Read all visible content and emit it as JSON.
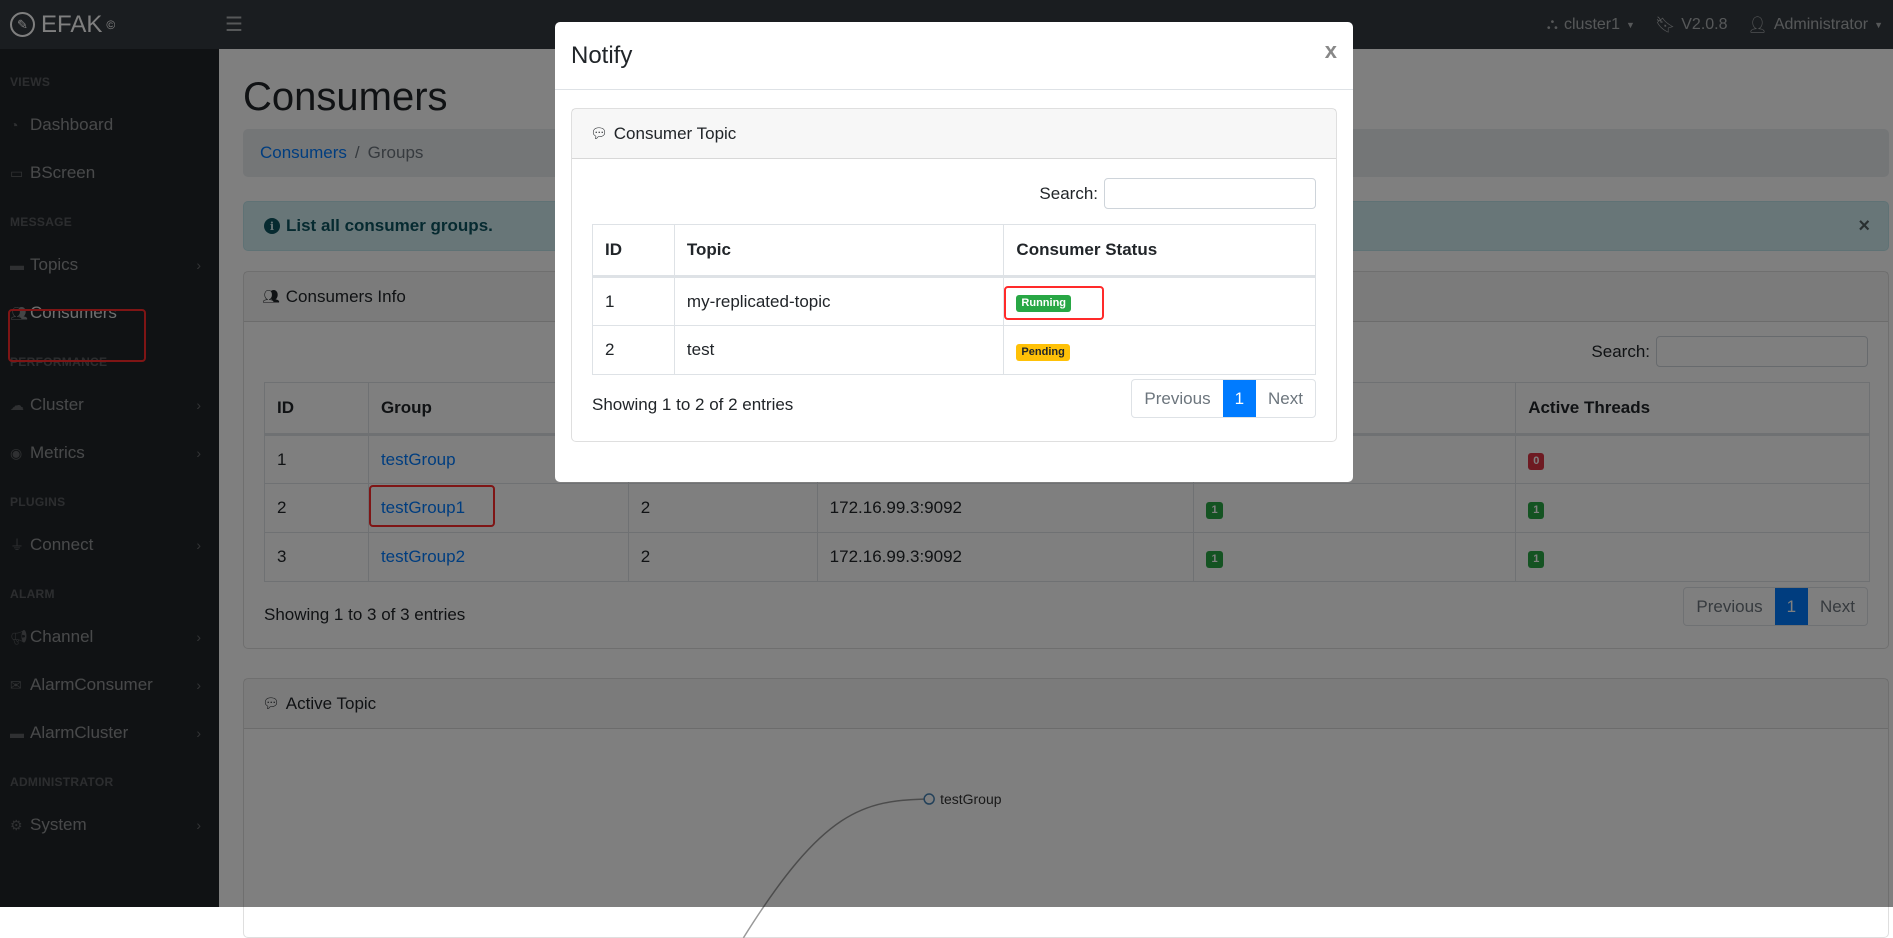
{
  "topbar": {
    "brand": "EFAK",
    "brand_mark": "©",
    "menu_icon": "hamburger-icon",
    "cluster": "cluster1",
    "version": "V2.0.8",
    "user": "Administrator"
  },
  "sidebar": {
    "sections": [
      {
        "heading": "VIEWS",
        "items": [
          {
            "label": "Dashboard",
            "icon": "dashboard-icon",
            "has_children": false
          },
          {
            "label": "BScreen",
            "icon": "monitor-icon",
            "has_children": false
          }
        ]
      },
      {
        "heading": "MESSAGE",
        "items": [
          {
            "label": "Topics",
            "icon": "comment-icon",
            "has_children": true
          },
          {
            "label": "Consumers",
            "icon": "users-icon",
            "has_children": false,
            "active": true
          }
        ]
      },
      {
        "heading": "PERFORMANCE",
        "items": [
          {
            "label": "Cluster",
            "icon": "cloud-icon",
            "has_children": true
          },
          {
            "label": "Metrics",
            "icon": "eye-icon",
            "has_children": true
          }
        ]
      },
      {
        "heading": "PLUGINS",
        "items": [
          {
            "label": "Connect",
            "icon": "plug-icon",
            "has_children": true
          }
        ]
      },
      {
        "heading": "ALARM",
        "items": [
          {
            "label": "Channel",
            "icon": "bullhorn-icon",
            "has_children": true
          },
          {
            "label": "AlarmConsumer",
            "icon": "envelope-icon",
            "has_children": true
          },
          {
            "label": "AlarmCluster",
            "icon": "hdd-icon",
            "has_children": true
          }
        ]
      },
      {
        "heading": "ADMINISTRATOR",
        "items": [
          {
            "label": "System",
            "icon": "user-cog-icon",
            "has_children": true
          }
        ]
      }
    ]
  },
  "main": {
    "title": "Consumers",
    "breadcrumb": {
      "link": "Consumers",
      "separator": "/",
      "current": "Groups"
    },
    "alert": {
      "text": "List all consumer groups.",
      "close": "×"
    },
    "consumers_card": {
      "title": "Consumers Info",
      "search_label": "Search:",
      "search_value": "",
      "columns": [
        "ID",
        "Group",
        "",
        "",
        "",
        "Active Threads"
      ],
      "rows": [
        {
          "id": "1",
          "group": "testGroup",
          "topics": "",
          "node": "",
          "active_topics": "",
          "active_threads": "0",
          "threads_color": "red"
        },
        {
          "id": "2",
          "group": "testGroup1",
          "topics": "2",
          "node": "172.16.99.3:9092",
          "active_topics": "1",
          "active_threads": "1",
          "threads_color": "green"
        },
        {
          "id": "3",
          "group": "testGroup2",
          "topics": "2",
          "node": "172.16.99.3:9092",
          "active_topics": "1",
          "active_threads": "1",
          "threads_color": "green"
        }
      ],
      "entries_text": "Showing 1 to 3 of 3 entries",
      "pager": {
        "previous": "Previous",
        "page": "1",
        "next": "Next"
      }
    },
    "active_topic_card": {
      "title": "Active Topic",
      "graph_nodes": [
        "testGroup"
      ]
    }
  },
  "modal": {
    "title": "Notify",
    "close": "x",
    "card_title": "Consumer Topic",
    "search_label": "Search:",
    "search_value": "",
    "columns": [
      "ID",
      "Topic",
      "Consumer Status"
    ],
    "rows": [
      {
        "id": "1",
        "topic": "my-replicated-topic",
        "status": "Running",
        "status_color": "green"
      },
      {
        "id": "2",
        "topic": "test",
        "status": "Pending",
        "status_color": "yellow"
      }
    ],
    "entries_text": "Showing 1 to 2 of 2 entries",
    "pager": {
      "previous": "Previous",
      "page": "1",
      "next": "Next"
    }
  },
  "colors": {
    "primary": "#007bff",
    "running": "#28a745",
    "pending": "#ffc107",
    "danger": "#dc3545",
    "annotation": "#ff2a2a"
  }
}
